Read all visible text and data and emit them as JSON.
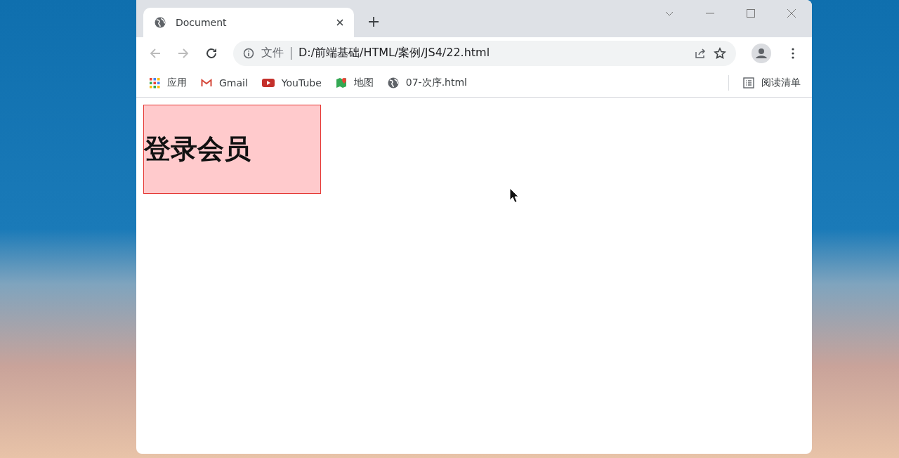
{
  "tabs": [
    {
      "title": "Document",
      "selected": true
    }
  ],
  "address_bar": {
    "scheme_label": "文件",
    "url": "D:/前端基础/HTML/案例/JS4/22.html"
  },
  "bookmarks": [
    {
      "label": "应用",
      "kind": "apps"
    },
    {
      "label": "Gmail",
      "kind": "gmail"
    },
    {
      "label": "YouTube",
      "kind": "youtube"
    },
    {
      "label": "地图",
      "kind": "maps"
    },
    {
      "label": "07-次序.html",
      "kind": "page"
    }
  ],
  "reading_list": {
    "label": "阅读清单"
  },
  "page": {
    "heading": "登录会员"
  }
}
